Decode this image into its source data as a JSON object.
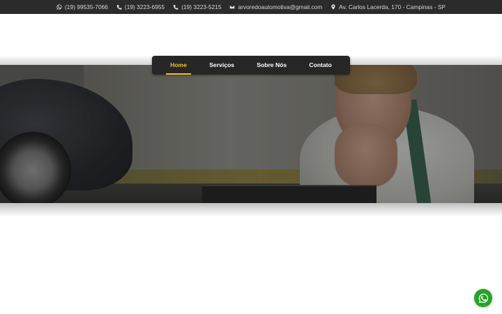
{
  "topbar": {
    "items": [
      {
        "icon": "whatsapp-icon",
        "text": "(19) 99535-7066"
      },
      {
        "icon": "phone-icon",
        "text": "(19) 3223-6955"
      },
      {
        "icon": "phone-icon",
        "text": "(19) 3223-5215"
      },
      {
        "icon": "envelope-icon",
        "text": "arvoredoautomotiva@gmail.com"
      },
      {
        "icon": "map-pin-icon",
        "text": "Av. Carlos Lacerda, 170 - Campinas - SP"
      }
    ]
  },
  "nav": {
    "items": [
      {
        "label": "Home",
        "active": true
      },
      {
        "label": "Serviços",
        "active": false
      },
      {
        "label": "Sobre Nós",
        "active": false
      },
      {
        "label": "Contato",
        "active": false
      }
    ]
  },
  "floating": {
    "icon": "whatsapp-icon"
  },
  "colors": {
    "accent": "#f2c218",
    "topbar_bg": "#2b2b2b",
    "nav_bg": "#262626",
    "whatsapp_green": "#27a327"
  }
}
